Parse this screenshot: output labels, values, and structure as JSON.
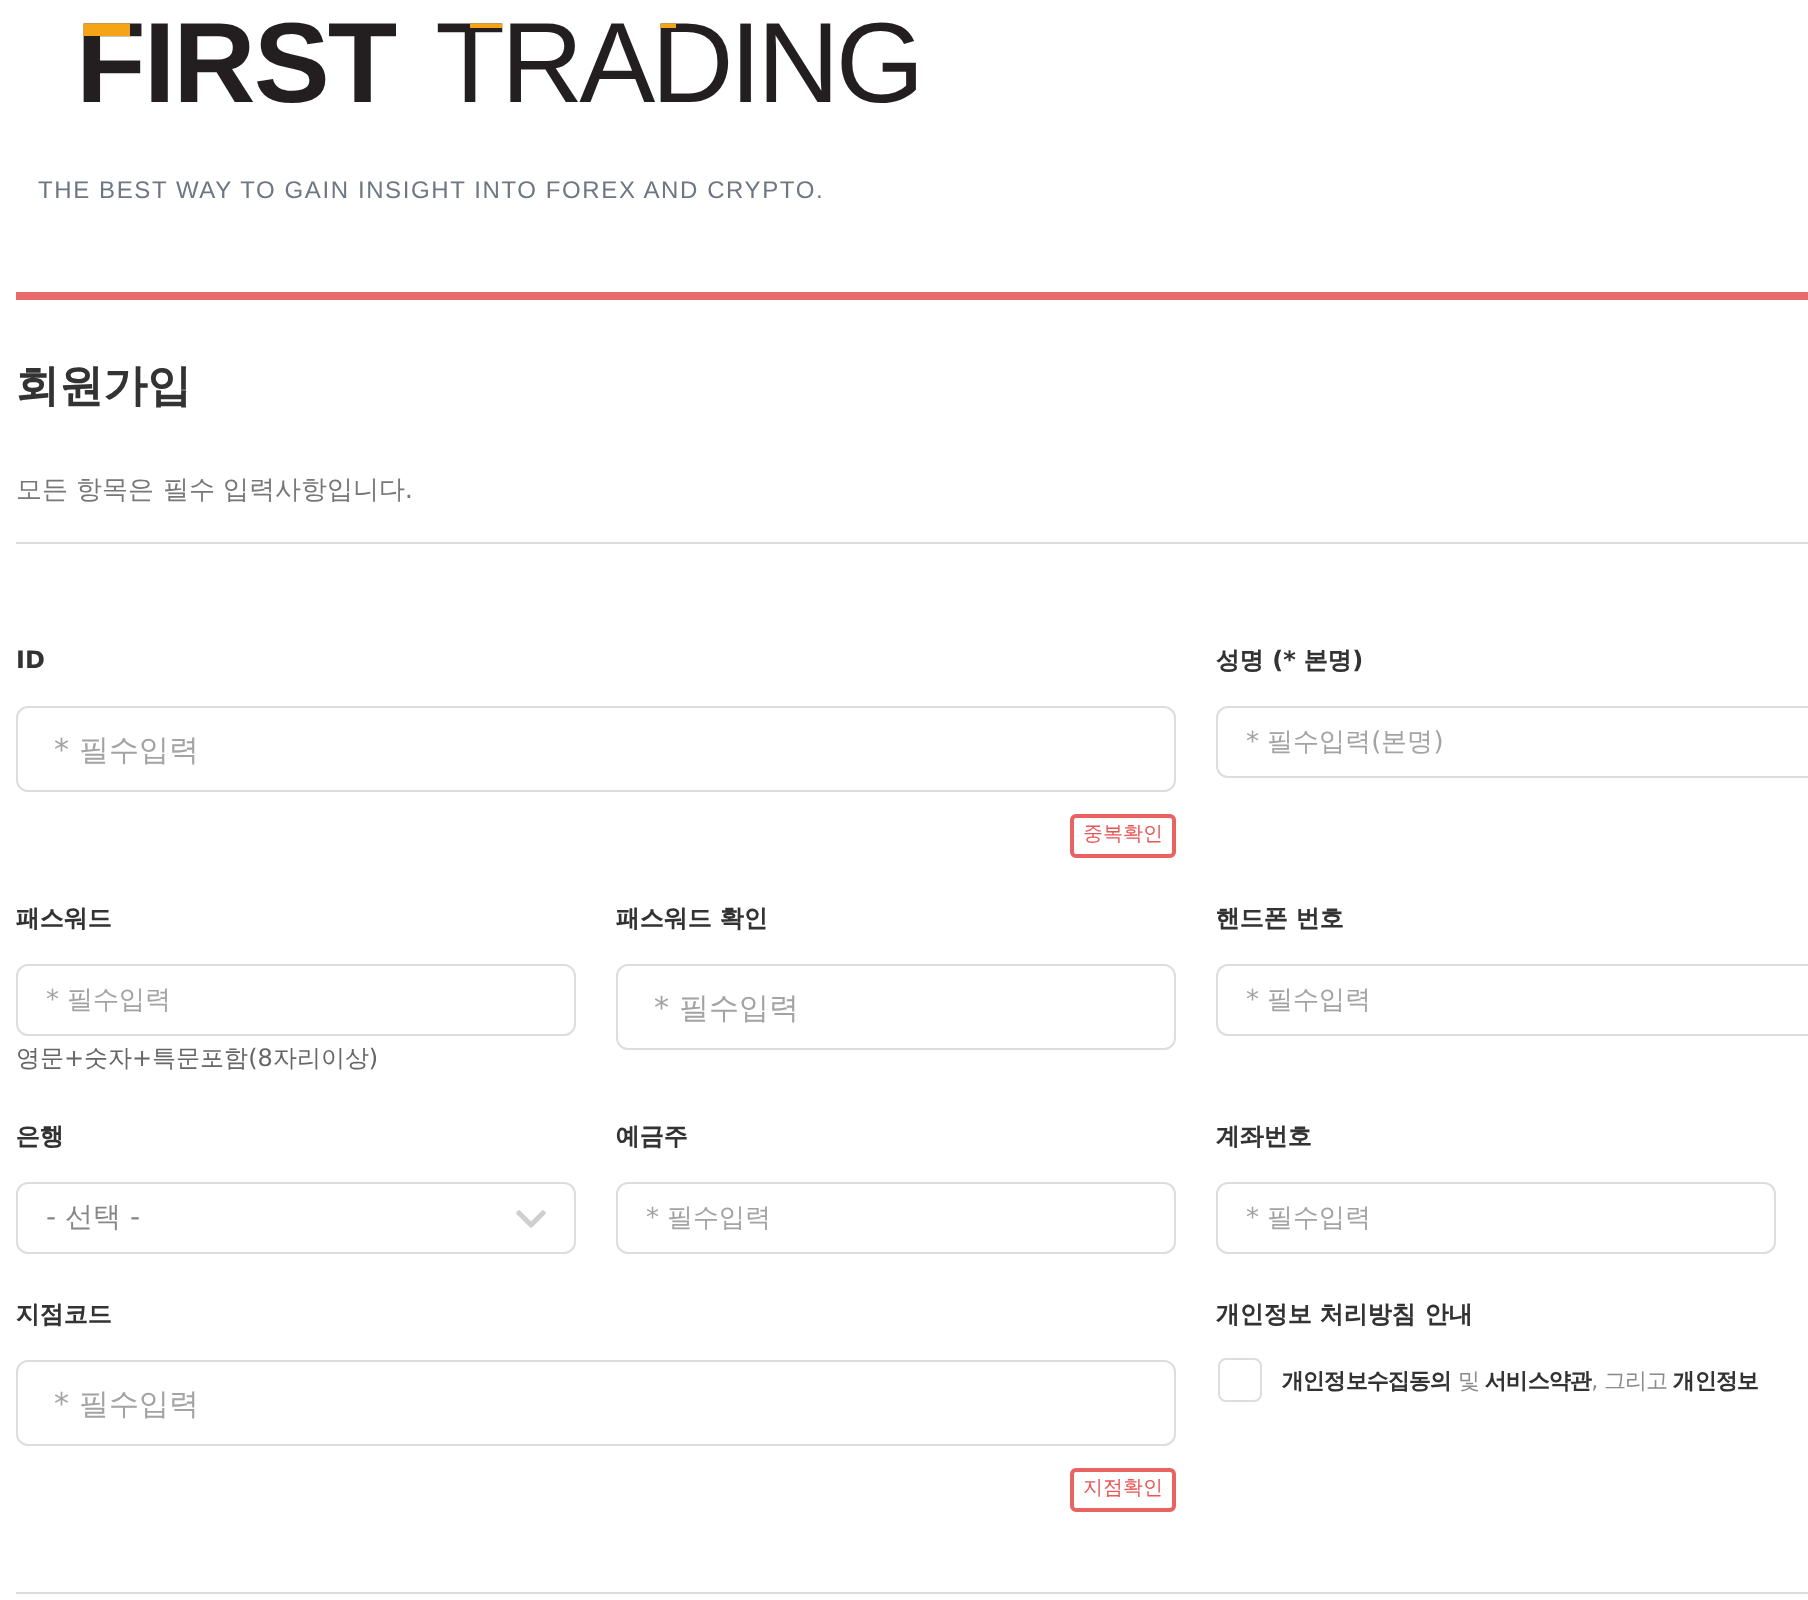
{
  "header": {
    "logo": {
      "bold_word": "FIRST",
      "thin_word": "TRADING"
    },
    "tagline": "THE BEST WAY TO GAIN INSIGHT INTO FOREX AND CRYPTO."
  },
  "page": {
    "title": "회원가입",
    "notice": "모든 항목은 필수 입력사항입니다."
  },
  "form": {
    "rows": [
      [
        {
          "kind": "wide",
          "label": "ID",
          "placeholder": "* 필수입력",
          "button": "중복확인"
        },
        {
          "kind": "text",
          "label": "성명 (* 본명)",
          "placeholder": "* 필수입력(본명)"
        }
      ],
      [
        {
          "kind": "text",
          "label": "패스워드",
          "placeholder": "* 필수입력",
          "hint": "영문+숫자+특문포함(8자리이상)"
        },
        {
          "kind": "tall",
          "label": "패스워드 확인",
          "placeholder": "* 필수입력"
        },
        {
          "kind": "text",
          "label": "핸드폰 번호",
          "placeholder": "* 필수입력"
        }
      ],
      [
        {
          "kind": "select",
          "label": "은행",
          "value": "- 선택 -"
        },
        {
          "kind": "text",
          "label": "예금주",
          "placeholder": "* 필수입력"
        },
        {
          "kind": "text",
          "label": "계좌번호",
          "placeholder": "* 필수입력"
        }
      ],
      [
        {
          "kind": "wide",
          "label": "지점코드",
          "placeholder": "* 필수입력",
          "button": "지점확인"
        },
        {
          "kind": "consent",
          "label": "개인정보 처리방침 안내",
          "checked": false,
          "text": "**개인정보수집동의** 및 **서비스약관**, 그리고 **개인정보**"
        }
      ]
    ]
  }
}
